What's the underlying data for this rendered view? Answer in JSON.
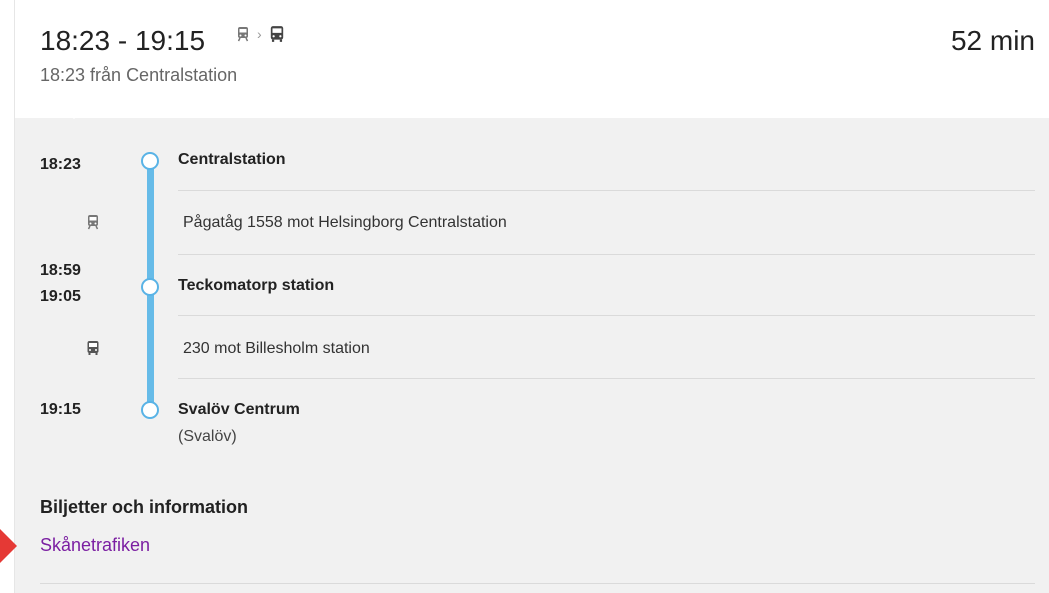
{
  "header": {
    "time_range": "18:23 - 19:15",
    "duration": "52 min",
    "departure_info": "18:23 från Centralstation",
    "mode_icons": [
      "train-icon",
      "bus-icon"
    ]
  },
  "itinerary": {
    "stops": [
      {
        "times": [
          "18:23"
        ],
        "name": "Centralstation",
        "sub": ""
      },
      {
        "times": [
          "18:59",
          "19:05"
        ],
        "name": "Teckomatorp station",
        "sub": ""
      },
      {
        "times": [
          "19:15"
        ],
        "name": "Svalöv Centrum",
        "sub": "(Svalöv)"
      }
    ],
    "legs": [
      {
        "icon": "train-icon",
        "text": "Pågatåg 1558 mot Helsingborg Centralstation"
      },
      {
        "icon": "bus-icon",
        "text": "230 mot Billesholm station"
      }
    ]
  },
  "tickets": {
    "title": "Biljetter och information",
    "link": "Skånetrafiken"
  },
  "colors": {
    "route_line": "#66bbe8",
    "link": "#7b1fa2",
    "panel_bg": "#f1f1f1"
  }
}
